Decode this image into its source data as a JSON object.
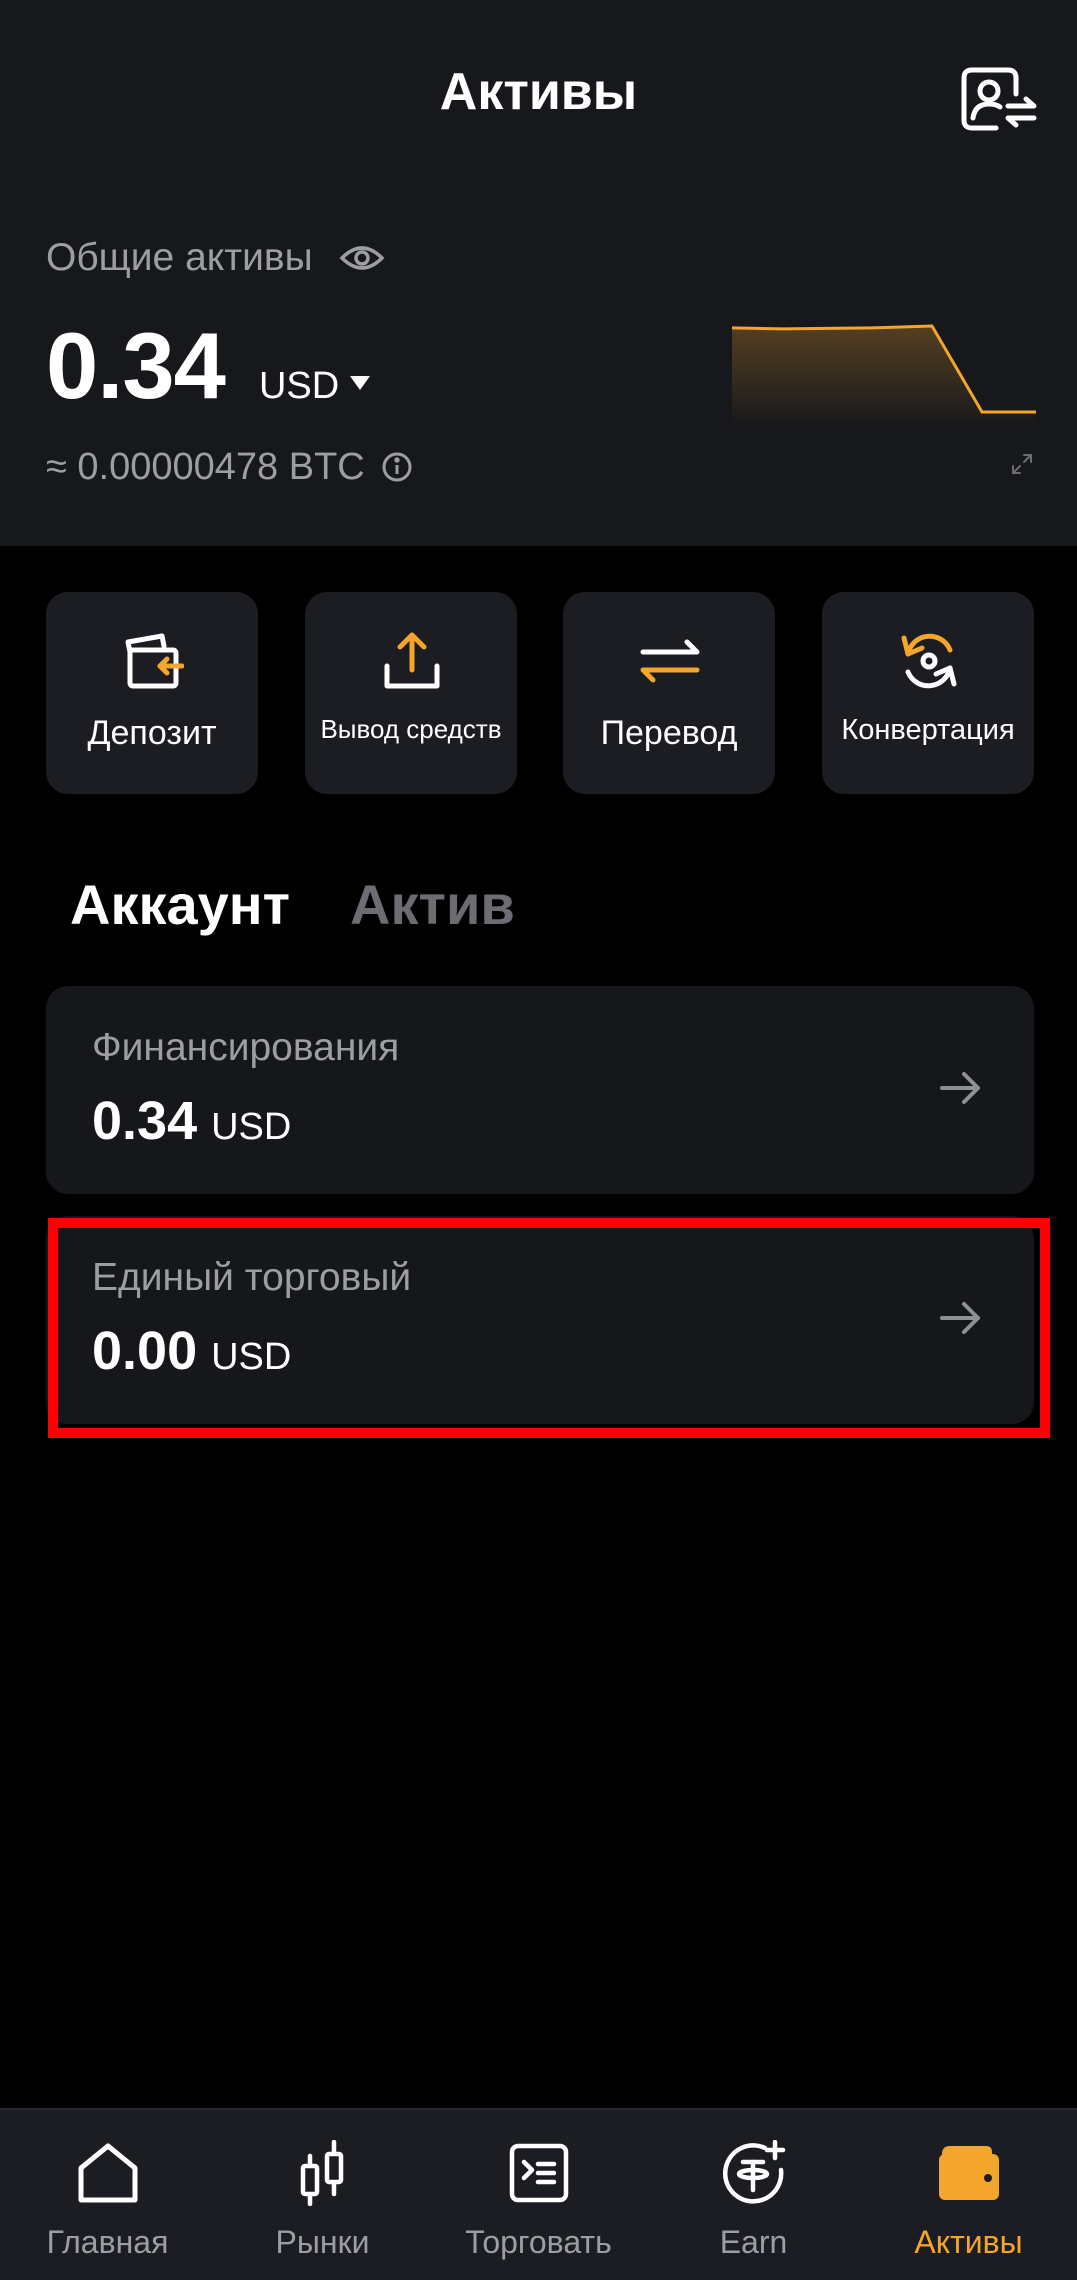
{
  "colors": {
    "accent": "#f3a52c",
    "header_bg": "#17181c",
    "card_bg": "#1c1d22",
    "highlight": "#ff0000"
  },
  "header": {
    "title": "Активы",
    "switch_icon": "account-switch-icon"
  },
  "summary": {
    "label": "Общие активы",
    "balance": "0.34",
    "currency": "USD",
    "btc_equivalent": "≈ 0.00000478 BTC"
  },
  "sparkline": {
    "type": "line",
    "values": [
      1.0,
      0.99,
      1.0,
      1.02,
      0.12,
      0.12
    ]
  },
  "actions": [
    {
      "label": "Депозит",
      "icon": "deposit-icon"
    },
    {
      "label": "Вывод средств",
      "icon": "withdraw-icon"
    },
    {
      "label": "Перевод",
      "icon": "transfer-icon"
    },
    {
      "label": "Конвертация",
      "icon": "convert-icon"
    }
  ],
  "tabs": [
    {
      "label": "Аккаунт",
      "active": true
    },
    {
      "label": "Актив",
      "active": false
    }
  ],
  "accounts": [
    {
      "title": "Финансирования",
      "amount": "0.34",
      "currency": "USD"
    },
    {
      "title": "Единый торговый",
      "amount": "0.00",
      "currency": "USD",
      "highlighted": true
    }
  ],
  "nav": [
    {
      "label": "Главная",
      "icon": "home-icon"
    },
    {
      "label": "Рынки",
      "icon": "candlestick-icon"
    },
    {
      "label": "Торговать",
      "icon": "trade-icon"
    },
    {
      "label": "Earn",
      "icon": "earn-icon"
    },
    {
      "label": "Активы",
      "icon": "wallet-icon",
      "active": true
    }
  ]
}
